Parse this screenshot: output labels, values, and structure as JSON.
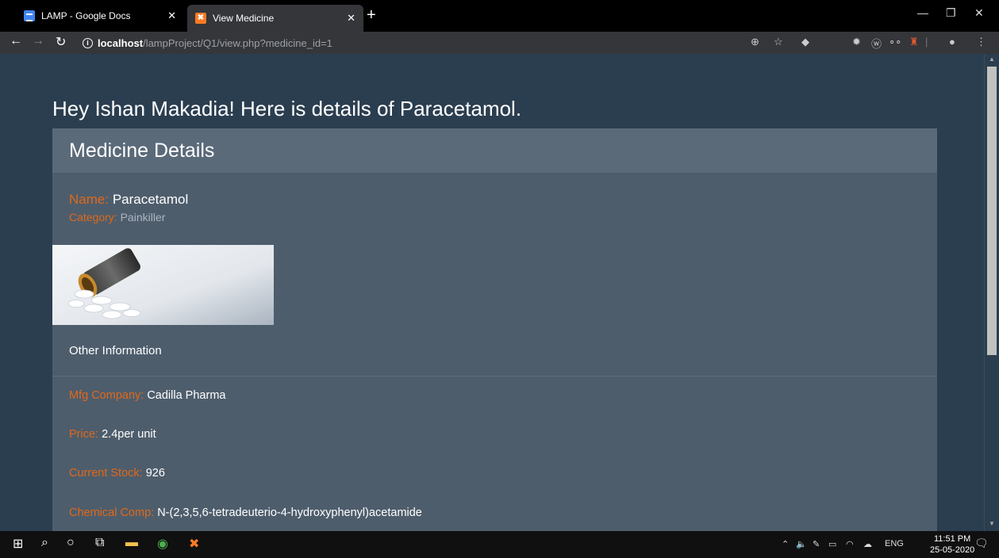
{
  "browser": {
    "tabs": [
      {
        "title": "LAMP - Google Docs",
        "favicon": "google-docs-icon"
      },
      {
        "title": "View Medicine",
        "favicon": "xampp-icon"
      }
    ],
    "url_host": "localhost",
    "url_path": "/lampProject/Q1/view.php?medicine_id=1"
  },
  "page": {
    "greeting": "Hey Ishan Makadia! Here is details of Paracetamol.",
    "panel_title": "Medicine Details",
    "name_label": "Name:",
    "name_value": "Paracetamol",
    "category_label": "Category:",
    "category_value": "Painkiller",
    "other_info": "Other Information",
    "mfg_label": "Mfg Company:",
    "mfg_value": "Cadilla Pharma",
    "price_label": "Price:",
    "price_value": "2.4per unit",
    "stock_label": "Current Stock:",
    "stock_value": "926",
    "chem_label": "Chemical Comp:",
    "chem_value": "N-(2,3,5,6-tetradeuterio-4-hydroxyphenyl)acetamide"
  },
  "taskbar": {
    "language": "ENG",
    "time": "11:51 PM",
    "date": "25-05-2020"
  },
  "colors": {
    "page_bg": "#2b3e50",
    "panel_bg": "#4e5d6c",
    "panel_heading_bg": "#5b6a79",
    "label_accent": "#df691a"
  }
}
